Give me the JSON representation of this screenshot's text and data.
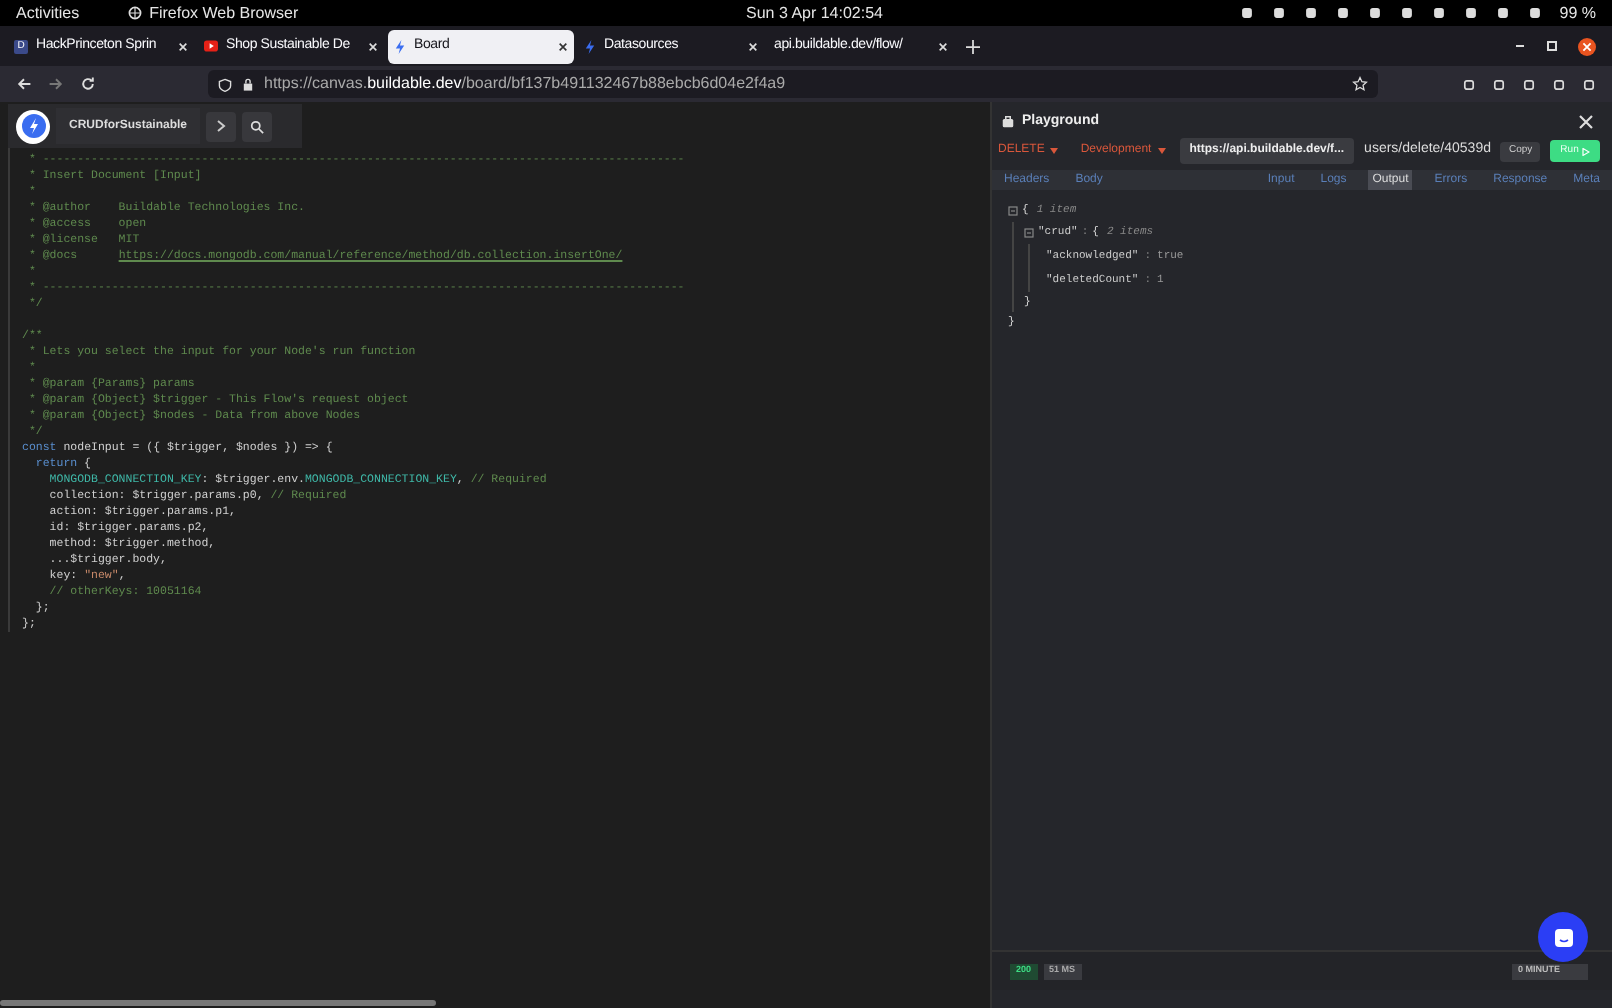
{
  "system_bar": {
    "activities": "Activities",
    "app": "Firefox Web Browser",
    "clock": "Sun 3 Apr  14:02:54",
    "battery": "99 %"
  },
  "browser_tabs": [
    {
      "label": "HackPrinceton Sprin",
      "selected": false,
      "kind": "letter",
      "badge": "D"
    },
    {
      "label": "Shop Sustainable De",
      "selected": false,
      "kind": "video"
    },
    {
      "label": "Board",
      "selected": true,
      "kind": "bolt"
    },
    {
      "label": "Datasources",
      "selected": false,
      "kind": "bolt"
    },
    {
      "label": "api.buildable.dev/flow/",
      "selected": false,
      "kind": "none"
    }
  ],
  "address": {
    "prefix": "https://canvas.",
    "domain": "buildable.dev",
    "path": "/board/bf137b491132467b88ebcb6d04e2f4a9"
  },
  "editor": {
    "flow_name": "CRUDforSustainable",
    "lines": [
      [
        {
          "kind": "comment",
          "text": " * ---------------------------------------------------------------------------------------------"
        }
      ],
      [
        {
          "kind": "comment",
          "text": " * Insert Document [Input]"
        }
      ],
      [
        {
          "kind": "comment",
          "text": " *"
        }
      ],
      [
        {
          "kind": "comment",
          "text": " * @author    Buildable Technologies Inc."
        }
      ],
      [
        {
          "kind": "comment",
          "text": " * @access    open"
        }
      ],
      [
        {
          "kind": "comment",
          "text": " * @license   MIT"
        }
      ],
      [
        {
          "kind": "comment",
          "text": " * @docs      "
        },
        {
          "kind": "link",
          "text": "https://docs.mongodb.com/manual/reference/method/db.collection.insertOne/"
        }
      ],
      [
        {
          "kind": "comment",
          "text": " *"
        }
      ],
      [
        {
          "kind": "comment",
          "text": " * ---------------------------------------------------------------------------------------------"
        }
      ],
      [
        {
          "kind": "comment",
          "text": " */"
        },
        {
          "kind": "gap"
        }
      ],
      [
        {
          "kind": "comment",
          "text": "/**"
        }
      ],
      [
        {
          "kind": "comment",
          "text": " * Lets you select the input for your Node's run function"
        }
      ],
      [
        {
          "kind": "comment",
          "text": " *"
        }
      ],
      [
        {
          "kind": "comment",
          "text": " * @param {Params} params"
        }
      ],
      [
        {
          "kind": "comment",
          "text": " * @param {Object} $trigger - This Flow's request object"
        }
      ],
      [
        {
          "kind": "comment",
          "text": " * @param {Object} $nodes - Data from above Nodes"
        }
      ],
      [
        {
          "kind": "comment",
          "text": " */"
        }
      ],
      [
        {
          "kind": "keyword",
          "text": "const"
        },
        {
          "kind": "plain",
          "text": " nodeInput = ({ $trigger, $nodes }) => {"
        }
      ],
      [
        {
          "kind": "keyword",
          "text": "  return"
        },
        {
          "kind": "plain",
          "text": " {"
        }
      ],
      [
        {
          "kind": "constant",
          "text": "    MONGODB_CONNECTION_KEY"
        },
        {
          "kind": "plain",
          "text": ": $trigger.env."
        },
        {
          "kind": "constant",
          "text": "MONGODB_CONNECTION_KEY"
        },
        {
          "kind": "plain",
          "text": ", "
        },
        {
          "kind": "comment",
          "text": "// Required"
        }
      ],
      [
        {
          "kind": "plain",
          "text": "    collection: $trigger.params.p0, "
        },
        {
          "kind": "comment",
          "text": "// Required"
        }
      ],
      [
        {
          "kind": "plain",
          "text": "    action: $trigger.params.p1,"
        }
      ],
      [
        {
          "kind": "plain",
          "text": "    id: $trigger.params.p2,"
        }
      ],
      [
        {
          "kind": "plain",
          "text": "    method: $trigger.method,"
        }
      ],
      [
        {
          "kind": "plain",
          "text": "    ...$trigger.body,"
        }
      ],
      [
        {
          "kind": "plain",
          "text": "    key: "
        },
        {
          "kind": "string",
          "text": "\"new\""
        },
        {
          "kind": "plain",
          "text": ","
        }
      ],
      [
        {
          "kind": "comment",
          "text": "    // otherKeys: 10051164"
        }
      ],
      [
        {
          "kind": "plain",
          "text": "  };"
        }
      ],
      [
        {
          "kind": "plain",
          "text": "};"
        }
      ]
    ]
  },
  "playground": {
    "title": "Playground",
    "method": "DELETE",
    "environment": "Development",
    "base_url": "https://api.buildable.dev/f...",
    "path": "users/delete/40539d",
    "copy": "Copy",
    "run": "Run",
    "left_tabs": [
      {
        "label": "Headers",
        "selected": false
      },
      {
        "label": "Body",
        "selected": false
      }
    ],
    "right_tabs": [
      {
        "label": "Input",
        "selected": false
      },
      {
        "label": "Logs",
        "selected": false
      },
      {
        "label": "Output",
        "selected": true
      },
      {
        "label": "Errors",
        "selected": false
      },
      {
        "label": "Response",
        "selected": false
      },
      {
        "label": "Meta",
        "selected": false
      }
    ],
    "tree": {
      "open": "{",
      "count": "1 item",
      "children": [
        {
          "key": "\"crud\"",
          "open": "{",
          "count": "2 items",
          "sep": ":",
          "entries": [
            {
              "key": "\"acknowledged\"",
              "sep": ":",
              "value": "true"
            },
            {
              "key": "\"deletedCount\"",
              "sep": ":",
              "value": "1"
            }
          ],
          "close": "}"
        }
      ],
      "close": "}"
    },
    "status": "200",
    "duration": "51 MS",
    "age": "0 MINUTE"
  }
}
